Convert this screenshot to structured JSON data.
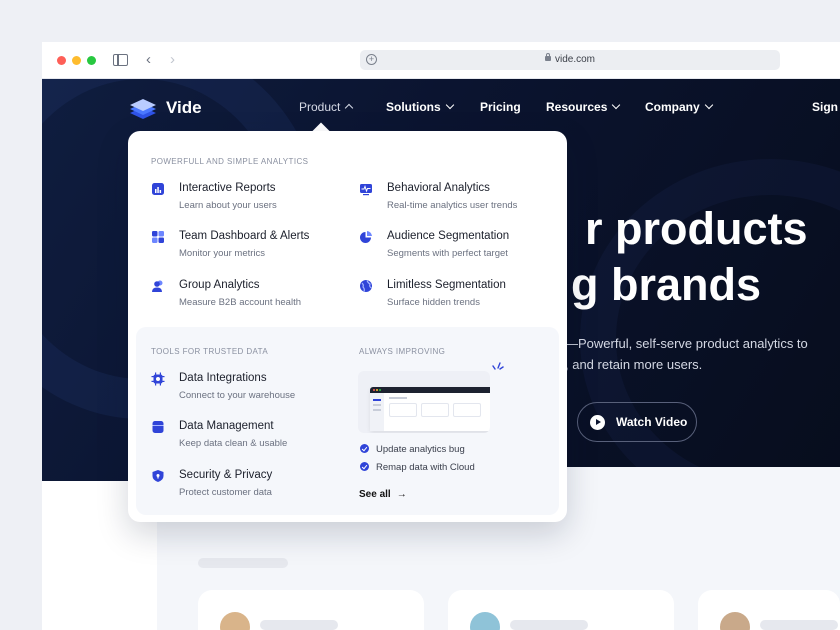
{
  "browser": {
    "url": "vide.com"
  },
  "nav": {
    "brand": "Vide",
    "items": [
      {
        "label": "Product"
      },
      {
        "label": "Solutions"
      },
      {
        "label": "Pricing"
      },
      {
        "label": "Resources"
      },
      {
        "label": "Company"
      },
      {
        "label": "Sign"
      }
    ]
  },
  "hero": {
    "line1": "r products",
    "line2": "g brands",
    "sub": "—Powerful, self-serve product analytics to , and retain more users.",
    "sub_line1": "—Powerful, self-serve product analytics to",
    "sub_line2": ", and retain more users.",
    "watch_label": "Watch Video"
  },
  "dropdown": {
    "analytics_title": "POWERFULL AND SIMPLE ANALYTICS",
    "analytics": [
      {
        "title": "Interactive Reports",
        "desc": "Learn about your users",
        "icon": "bar-chart-icon"
      },
      {
        "title": "Behavioral Analytics",
        "desc": "Real-time analytics user trends",
        "icon": "pulse-icon"
      },
      {
        "title": "Team Dashboard & Alerts",
        "desc": "Monitor your metrics",
        "icon": "grid-icon"
      },
      {
        "title": "Audience Segmentation",
        "desc": "Segments with perfect target",
        "icon": "pie-chart-icon"
      },
      {
        "title": "Group Analytics",
        "desc": "Measure B2B account health",
        "icon": "users-icon"
      },
      {
        "title": "Limitless Segmentation",
        "desc": "Surface hidden trends",
        "icon": "globe-icon"
      }
    ],
    "tools_title": "TOOLS FOR TRUSTED DATA",
    "tools": [
      {
        "title": "Data Integrations",
        "desc": "Connect to your warehouse",
        "icon": "chip-icon"
      },
      {
        "title": "Data Management",
        "desc": "Keep data clean & usable",
        "icon": "database-icon"
      },
      {
        "title": "Security & Privacy",
        "desc": "Protect customer data",
        "icon": "shield-icon"
      }
    ],
    "improving_title": "ALWAYS IMPROVING",
    "updates": [
      {
        "label": "Update analytics bug"
      },
      {
        "label": "Remap data with Cloud"
      }
    ],
    "see_all": "See all"
  },
  "colors": {
    "accent": "#3044d8",
    "hero_bg": "#0b1430"
  }
}
